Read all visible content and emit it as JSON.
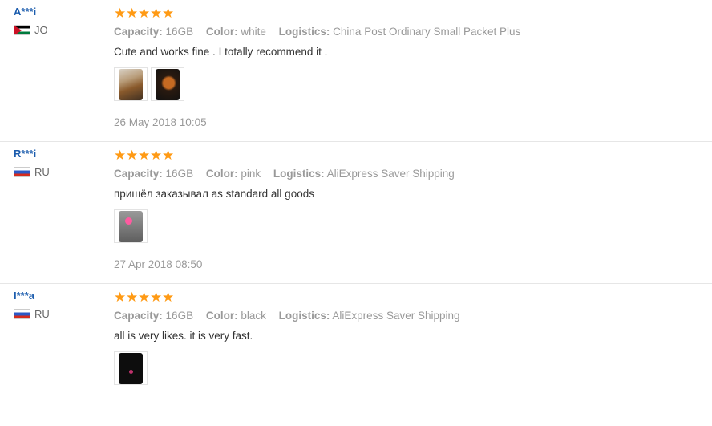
{
  "labels": {
    "capacity": "Capacity:",
    "color": "Color:",
    "logistics": "Logistics:"
  },
  "reviews": [
    {
      "user": "A***i",
      "country": "JO",
      "flag": "jo-flag",
      "stars": 5,
      "capacity": "16GB",
      "color": "white",
      "logistics": "China Post Ordinary Small Packet Plus",
      "text": "Cute and works fine . I totally recommend it .",
      "photos": [
        "photo-thumbnail",
        "photo-thumbnail"
      ],
      "date": "26 May 2018 10:05"
    },
    {
      "user": "R***i",
      "country": "RU",
      "flag": "ru-flag",
      "stars": 5,
      "capacity": "16GB",
      "color": "pink",
      "logistics": "AliExpress Saver Shipping",
      "text": "пришёл заказывал as standard all goods",
      "photos": [
        "photo-thumbnail"
      ],
      "date": "27 Apr 2018 08:50"
    },
    {
      "user": "I***a",
      "country": "RU",
      "flag": "ru-flag",
      "stars": 5,
      "capacity": "16GB",
      "color": "black",
      "logistics": "AliExpress Saver Shipping",
      "text": "all is very likes. it is very fast.",
      "photos": [
        "photo-thumbnail"
      ],
      "date": ""
    }
  ],
  "colors": {
    "star": "#ff9a14",
    "username": "#1b5cad",
    "meta": "#999999"
  }
}
